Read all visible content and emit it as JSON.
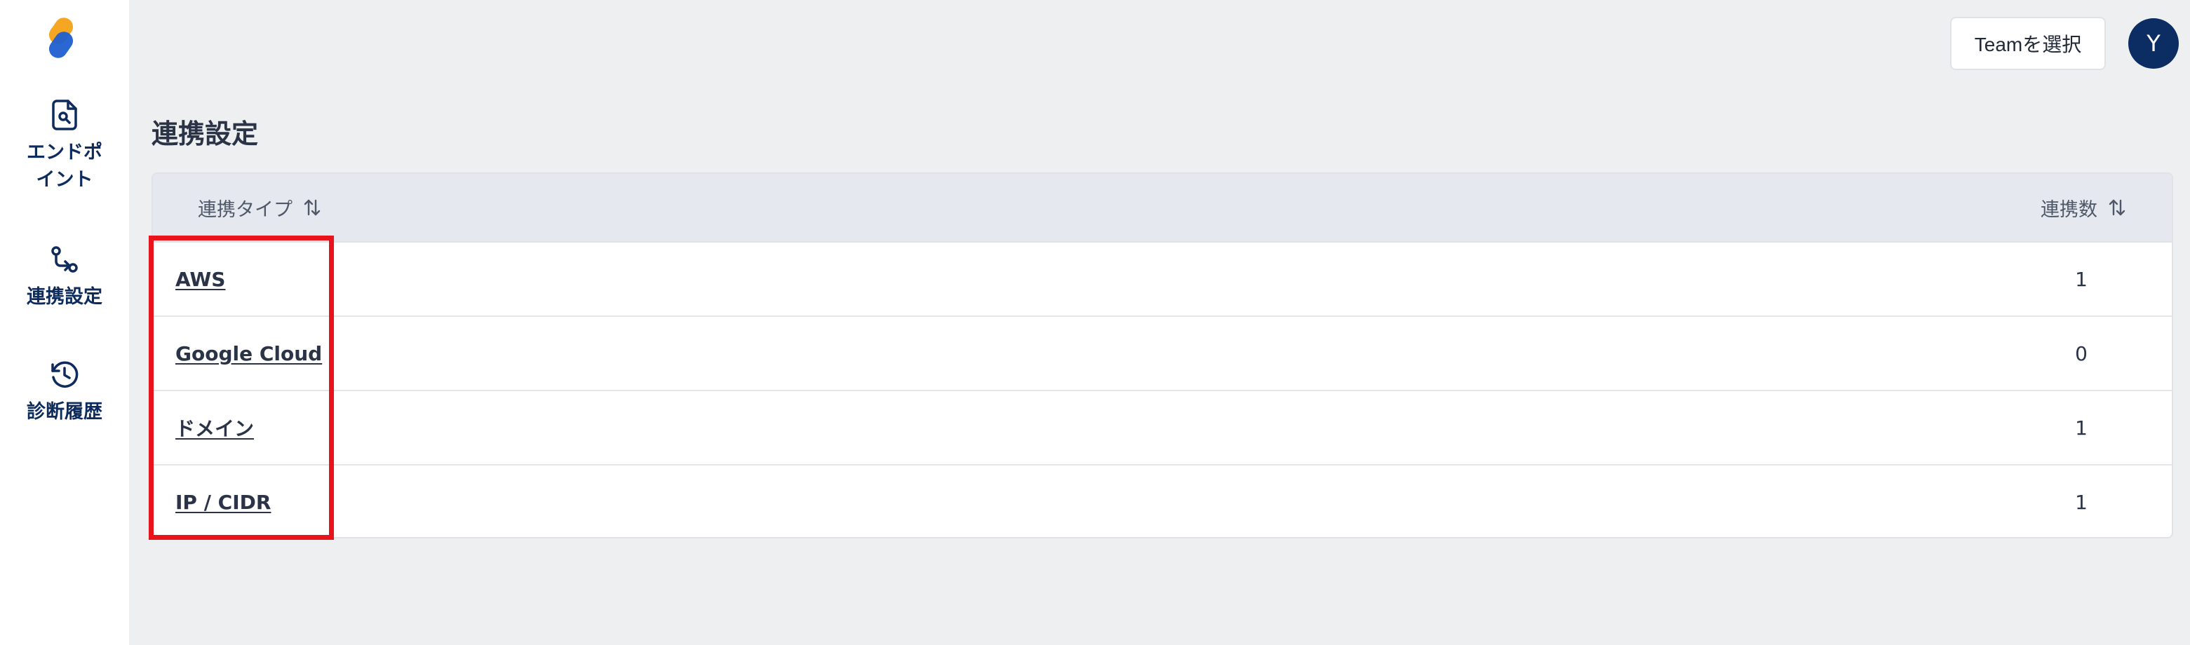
{
  "sidebar": {
    "items": [
      {
        "label": "エンドポイント",
        "icon": "file-search-icon"
      },
      {
        "label": "連携設定",
        "icon": "git-pull-request-icon"
      },
      {
        "label": "診断履歴",
        "icon": "history-icon"
      }
    ]
  },
  "header": {
    "team_button_label": "Teamを選択",
    "avatar_initial": "Y"
  },
  "page": {
    "title": "連携設定"
  },
  "table": {
    "columns": [
      "連携タイプ",
      "連携数"
    ],
    "rows": [
      {
        "type": "AWS",
        "count": "1"
      },
      {
        "type": "Google Cloud",
        "count": "0"
      },
      {
        "type": "ドメイン",
        "count": "1"
      },
      {
        "type": "IP / CIDR",
        "count": "1"
      }
    ]
  },
  "colors": {
    "brand_navy": "#0b2d63",
    "highlight_red": "#e8131b",
    "logo_orange": "#f5a623",
    "logo_blue": "#1f5fd1"
  }
}
